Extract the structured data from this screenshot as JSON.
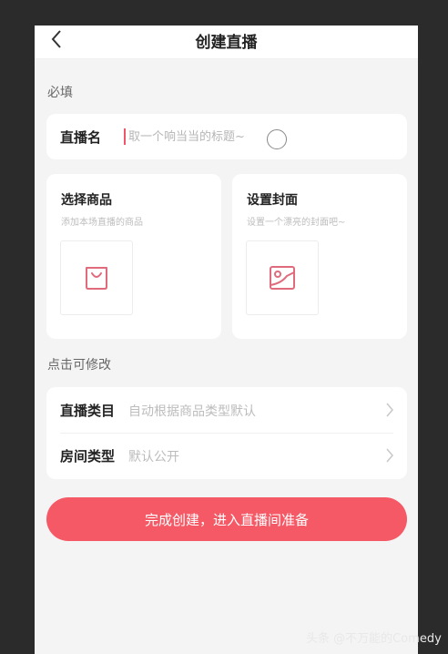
{
  "header": {
    "title": "创建直播"
  },
  "required_section": {
    "label": "必填",
    "title_field": {
      "label": "直播名",
      "placeholder": "取一个响当当的标题~"
    }
  },
  "cards": {
    "product": {
      "title": "选择商品",
      "subtitle": "添加本场直播的商品",
      "icon": "shopping-bag-icon"
    },
    "cover": {
      "title": "设置封面",
      "subtitle": "设置一个漂亮的封面吧~",
      "icon": "image-icon"
    }
  },
  "editable_section": {
    "label": "点击可修改",
    "rows": [
      {
        "label": "直播类目",
        "value": "自动根据商品类型默认"
      },
      {
        "label": "房间类型",
        "value": "默认公开"
      }
    ]
  },
  "submit": {
    "label": "完成创建，进入直播间准备"
  },
  "watermark": {
    "text": "头条 @不万能的Comedy"
  },
  "colors": {
    "accent": "#f55966",
    "icon_pink": "#e06b7d",
    "background": "#f4f4f4"
  }
}
